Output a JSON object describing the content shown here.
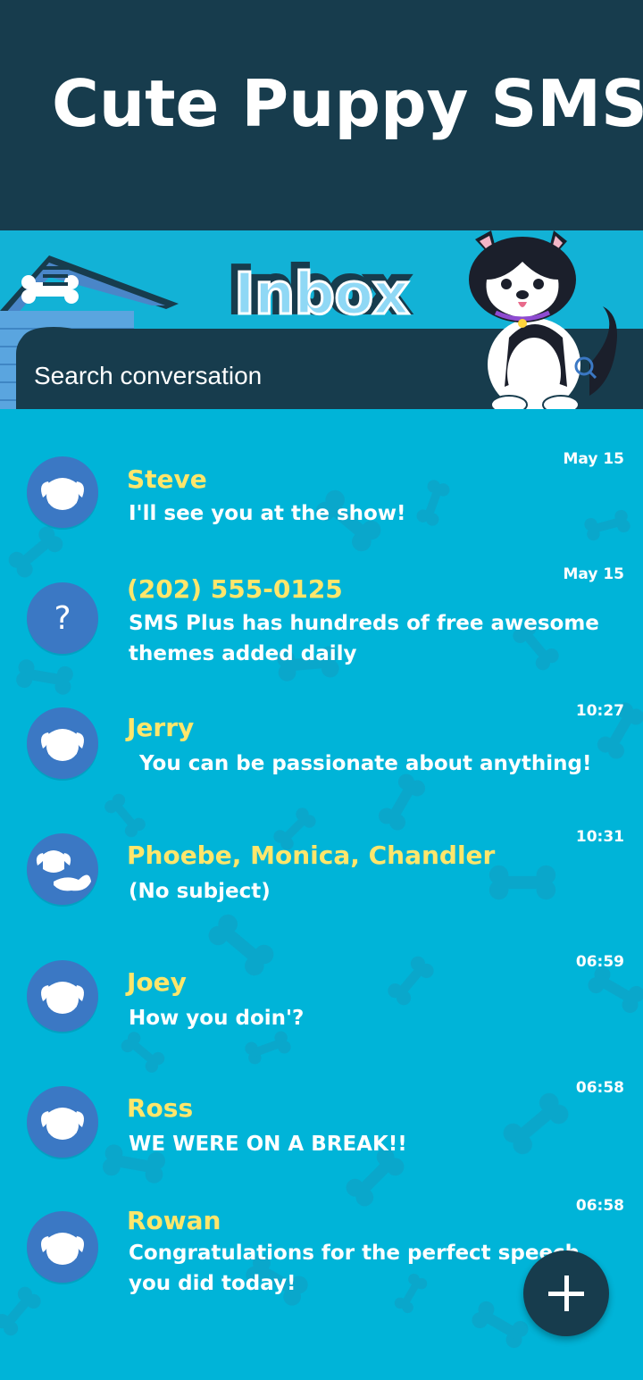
{
  "banner": {
    "title": "Cute Puppy SMS"
  },
  "header": {
    "title": "Inbox",
    "search_placeholder": "Search conversation"
  },
  "conversations": [
    {
      "name": "Steve",
      "preview": "I'll see you at the show!",
      "time": "May 15",
      "avatar": "dog-avatar"
    },
    {
      "name": "(202) 555-0125",
      "preview": "SMS Plus has hundreds of free awesome themes added daily",
      "time": "May 15",
      "avatar": "unknown-avatar"
    },
    {
      "name": "Jerry",
      "preview": "You can be passionate about anything!",
      "time": "10:27",
      "avatar": "dog-avatar"
    },
    {
      "name": "Phoebe, Monica, Chandler",
      "preview": "(No subject)",
      "time": "10:31",
      "avatar": "group-dog-avatar"
    },
    {
      "name": "Joey",
      "preview": "How you doin'?",
      "time": "06:59",
      "avatar": "dog-avatar"
    },
    {
      "name": "Ross",
      "preview": "WE WERE ON A BREAK!!",
      "time": "06:58",
      "avatar": "dog-avatar"
    },
    {
      "name": "Rowan",
      "preview": "Congratulations for the perfect speech you did today!",
      "time": "06:58",
      "avatar": "dog-avatar"
    }
  ],
  "fab": {
    "icon": "plus-icon"
  },
  "colors": {
    "banner_bg": "#173c4d",
    "list_bg": "#00b4d8",
    "name_color": "#ffe66b",
    "avatar_bg": "#3b78c4"
  }
}
